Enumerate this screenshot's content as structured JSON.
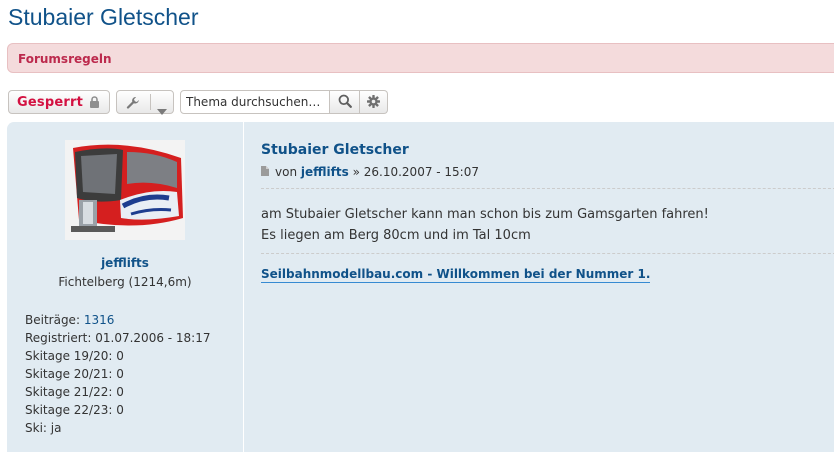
{
  "topic": {
    "title": "Stubaier Gletscher"
  },
  "rules": {
    "label": "Forumsregeln"
  },
  "actions": {
    "locked_label": "Gesperrt",
    "search_placeholder": "Thema durchsuchen…"
  },
  "profile": {
    "username": "jefflifts",
    "location": "Fichtelberg (1214,6m)",
    "fields": [
      {
        "label": "Beiträge:",
        "value": "1316"
      },
      {
        "label": "Registriert:",
        "value": "01.07.2006 - 18:17"
      },
      {
        "label": "Skitage 19/20:",
        "value": "0"
      },
      {
        "label": "Skitage 20/21:",
        "value": "0"
      },
      {
        "label": "Skitage 21/22:",
        "value": "0"
      },
      {
        "label": "Skitage 22/23:",
        "value": "0"
      },
      {
        "label": "Ski:",
        "value": "ja"
      }
    ]
  },
  "post": {
    "title": "Stubaier Gletscher",
    "meta_prefix": "von",
    "author": "jefflifts",
    "meta_sep": "»",
    "date": "26.10.2007 - 15:07",
    "content": [
      "am Stubaier Gletscher kann man schon bis zum Gamsgarten fahren!",
      "Es liegen am Berg 80cm und im Tal 10cm"
    ],
    "signature": "Seilbahnmodellbau.com - Willkommen bei der Nummer 1."
  },
  "colors": {
    "link": "#105289",
    "locked": "#d31141",
    "rules_bg": "#f4dbdc",
    "post_bg": "#e1ebf2"
  }
}
